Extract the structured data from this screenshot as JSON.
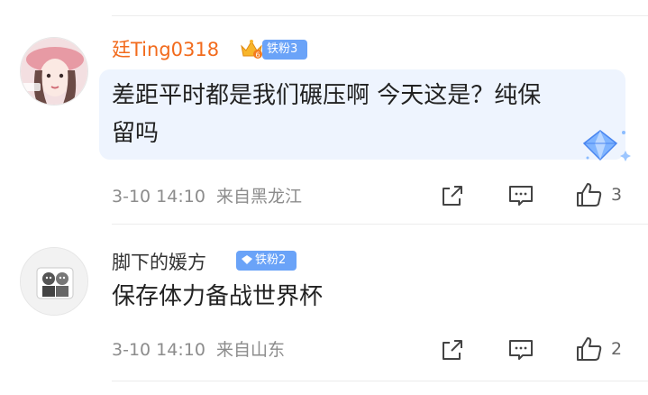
{
  "comments": [
    {
      "username": "廷Ting0318",
      "fan_badge": "铁粉3",
      "crown_level": "6",
      "text_line1": "差距平时都是我们碾压啊 今天这是？纯保",
      "text_line2": "留吗",
      "date": "3-10 14:10",
      "location": "来自黑龙江",
      "likes": "3"
    },
    {
      "username": "脚下的媛方",
      "fan_badge": "铁粉2",
      "text": "保存体力备战世界杯",
      "date": "3-10 14:10",
      "location": "来自山东",
      "likes": "2"
    }
  ],
  "colors": {
    "vip_name": "#f26b1d",
    "badge_blue": "#6aa3f8",
    "bubble": "#eef4fe",
    "meta": "#8c8c8c"
  },
  "icons": [
    "crown-icon",
    "diamond-icon",
    "share-icon",
    "comment-icon",
    "like-icon"
  ]
}
